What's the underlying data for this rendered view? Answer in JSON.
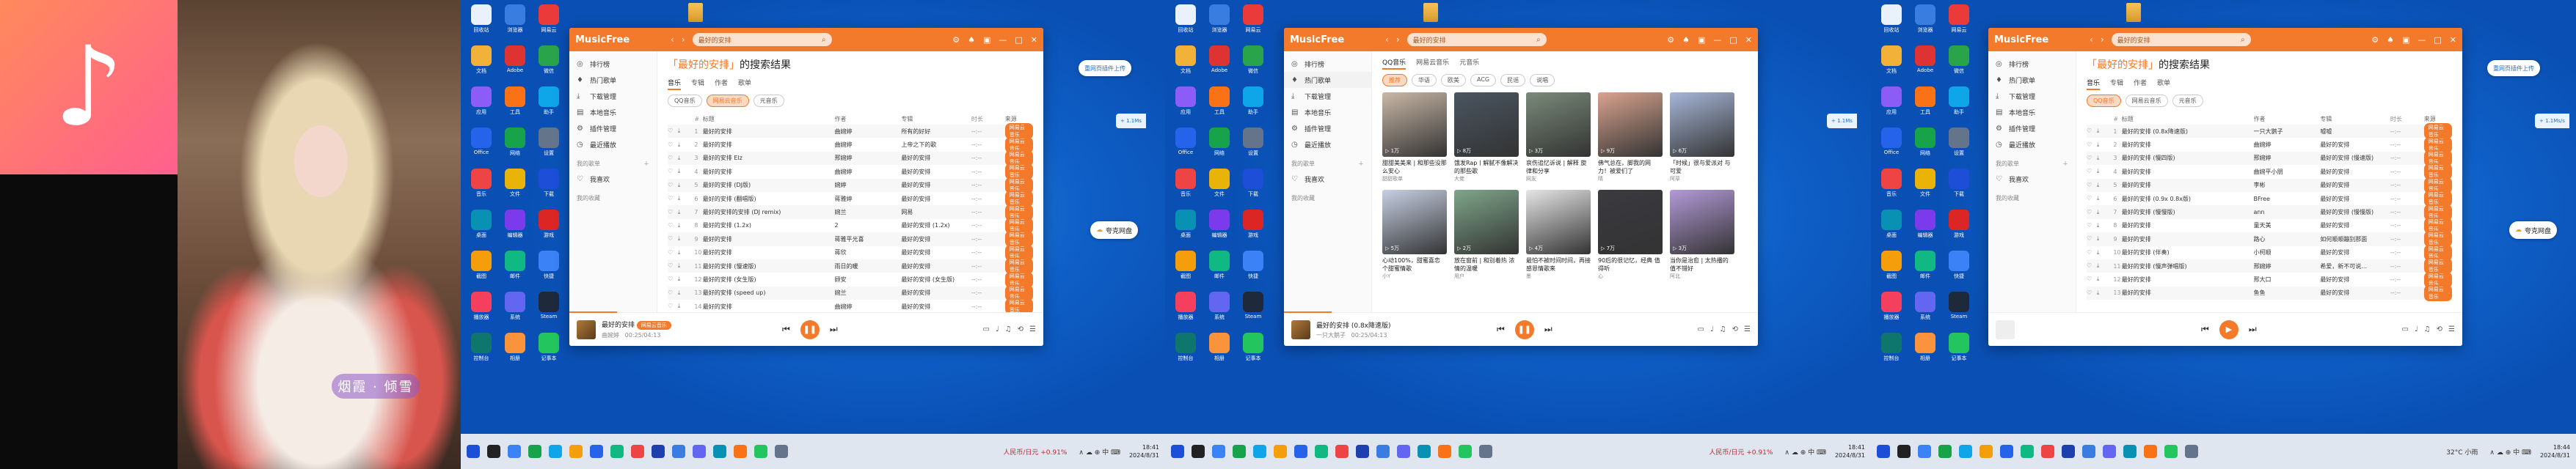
{
  "promo": {
    "caption": "烟霞 · 倾雪"
  },
  "app": {
    "name": "MusicFree",
    "search_value": "最好的安排",
    "window_controls": [
      "⚙",
      "♠",
      "▣",
      "—",
      "□",
      "✕"
    ]
  },
  "sidebar": {
    "items": [
      {
        "icon": "◎",
        "label": "排行榜"
      },
      {
        "icon": "♦",
        "label": "热门歌单"
      },
      {
        "icon": "⤓",
        "label": "下载管理"
      },
      {
        "icon": "▤",
        "label": "本地音乐"
      },
      {
        "icon": "⚙",
        "label": "插件管理"
      },
      {
        "icon": "◷",
        "label": "最近播放"
      }
    ],
    "my_playlists": "我的歌单",
    "favorites": "我喜欢",
    "starred": "我的收藏"
  },
  "result_title": {
    "keyword": "「最好的安排」",
    "suffix": "的搜索结果"
  },
  "tabs": [
    "音乐",
    "专辑",
    "作者",
    "歌单"
  ],
  "tabs2": [
    "音乐",
    "专辑",
    "作者",
    "歌单"
  ],
  "plugins1": [
    "QQ音乐",
    "网易云音乐",
    "元音乐"
  ],
  "plugins2_head": [
    "QQ音乐",
    "网易云音乐",
    "元音乐"
  ],
  "plugins2": [
    "推荐",
    "华语",
    "欧美",
    "ACG",
    "民谣",
    "说唱"
  ],
  "columns": {
    "title": "标题",
    "artist": "作者",
    "album": "专辑",
    "duration": "时长",
    "source": "来源"
  },
  "songs1": [
    {
      "title": "最好的安排",
      "artist": "曲婉婷",
      "album": "所有的好好",
      "dur": "--:--",
      "src": "网易云音乐"
    },
    {
      "title": "最好的安排",
      "artist": "曲婉婷",
      "album": "上帝之下的歌",
      "dur": "--:--",
      "src": "网易云音乐"
    },
    {
      "title": "最好的安排 Elz",
      "artist": "邢婉婷",
      "album": "最好的安排",
      "dur": "--:--",
      "src": "网易云音乐"
    },
    {
      "title": "最好的安排",
      "artist": "曲婉婷",
      "album": "最好的安排",
      "dur": "--:--",
      "src": "网易云音乐"
    },
    {
      "title": "最好的安排 (DJ版)",
      "artist": "婉婷",
      "album": "最好的安排",
      "dur": "--:--",
      "src": "网易云音乐"
    },
    {
      "title": "最好的安排 (翻唱版)",
      "artist": "蒋雅婷",
      "album": "最好的安排",
      "dur": "--:--",
      "src": "网易云音乐"
    },
    {
      "title": "最好的安排的安排 (DJ remix)",
      "artist": "婉兰",
      "album": "网易",
      "dur": "--:--",
      "src": "网易云音乐"
    },
    {
      "title": "最好的安排 (1.2x)",
      "artist": "2",
      "album": "最好的安排 (1.2x)",
      "dur": "--:--",
      "src": "网易云音乐"
    },
    {
      "title": "最好的安排",
      "artist": "蒋雅平光喜",
      "album": "最好的安排",
      "dur": "--:--",
      "src": "网易云音乐"
    },
    {
      "title": "最好的安排",
      "artist": "蒋欣",
      "album": "最好的安排",
      "dur": "--:--",
      "src": "网易云音乐"
    },
    {
      "title": "最好的安排 (慢速版)",
      "artist": "雨日的暖",
      "album": "最好的安排",
      "dur": "--:--",
      "src": "网易云音乐"
    },
    {
      "title": "最好的安排 (女生版)",
      "artist": "顾安",
      "album": "最好的安排 (女生版)",
      "dur": "--:--",
      "src": "网易云音乐"
    },
    {
      "title": "最好的安排 (speed up)",
      "artist": "婉兰",
      "album": "最好的安排",
      "dur": "--:--",
      "src": "网易云音乐"
    },
    {
      "title": "最好的安排",
      "artist": "曲婉婷",
      "album": "最好的安排",
      "dur": "--:--",
      "src": "网易云音乐"
    }
  ],
  "songs3": [
    {
      "title": "最好的安排 (0.8x降速版)",
      "artist": "一只大鹅子",
      "album": "嘘嘘",
      "dur": "--:--",
      "src": "网易云音乐"
    },
    {
      "title": "最好的安排",
      "artist": "曲婉婷",
      "album": "最好的安排",
      "dur": "--:--",
      "src": "网易云音乐"
    },
    {
      "title": "最好的安排 (慢四版)",
      "artist": "邢婉婷",
      "album": "最好的安排 (慢速版)",
      "dur": "--:--",
      "src": "网易云音乐"
    },
    {
      "title": "最好的安排",
      "artist": "曲婉平小朋",
      "album": "最好的安排",
      "dur": "--:--",
      "src": "网易云音乐"
    },
    {
      "title": "最好的安排",
      "artist": "李彬",
      "album": "最好的安排",
      "dur": "--:--",
      "src": "网易云音乐"
    },
    {
      "title": "最好的安排 (0.9x 0.8x版)",
      "artist": "BFree",
      "album": "最好的安排",
      "dur": "--:--",
      "src": "网易云音乐"
    },
    {
      "title": "最好的安排 (慢慢版)",
      "artist": "ann",
      "album": "最好的安排 (慢慢版)",
      "dur": "--:--",
      "src": "网易云音乐"
    },
    {
      "title": "最好的安排",
      "artist": "童天美",
      "album": "最好的安排",
      "dur": "--:--",
      "src": "网易云音乐"
    },
    {
      "title": "最好的安排",
      "artist": "路心",
      "album": "如何顺顺蹦别那面",
      "dur": "--:--",
      "src": "网易云音乐"
    },
    {
      "title": "最好的安排 (伴奏)",
      "artist": "小柯顺",
      "album": "最好的安排",
      "dur": "--:--",
      "src": "网易云音乐"
    },
    {
      "title": "最好的安排 (慢声弹唱版)",
      "artist": "邢婉婷",
      "album": "希爱，新不可说...",
      "dur": "--:--",
      "src": "网易云音乐"
    },
    {
      "title": "最好的安排",
      "artist": "邢大口",
      "album": "最好的安排",
      "dur": "--:--",
      "src": "网易云音乐"
    },
    {
      "title": "最好的安排",
      "artist": "鱼鱼",
      "album": "最好的安排",
      "dur": "--:--",
      "src": "网易云音乐"
    }
  ],
  "albums": [
    {
      "title": "甜甜美美来 | 和那些没那么安心",
      "user": "甜甜歌单",
      "views": "▷ 1万"
    },
    {
      "title": "饿发Rap丨解腻不像解决 的那些歌",
      "user": "大佬",
      "views": "▷ 8万"
    },
    {
      "title": "哀伤追忆诉说 | 解释 旋律和分享",
      "user": "网友",
      "views": "▷ 3万"
    },
    {
      "title": "佛气总在，脚我的网 力！被爱们了",
      "user": "晴",
      "views": "▷ 9万"
    },
    {
      "title": "「时候」很与爱派对 与可爱",
      "user": "阿草",
      "views": "▷ 6万"
    },
    {
      "title": "心动100%，甜蜜喜恋 个甜蜜情歌",
      "user": "小Y",
      "views": "▷ 5万"
    },
    {
      "title": "放在窗前 | 和别着热 浓情的温暖",
      "user": "用户",
      "views": "▷ 2万"
    },
    {
      "title": "最怕不被时间时间，再接 感恩情歌来",
      "user": "墨",
      "views": "▷ 4万"
    },
    {
      "title": "90后的很记忆，经典 值得听",
      "user": "心",
      "views": "▷ 7万"
    },
    {
      "title": "当你是治愈 | 太热播的 值不错好",
      "user": "阿北",
      "views": "▷ 3万"
    }
  ],
  "player1": {
    "song": "最好的安排",
    "sub": "曲婉婷",
    "time": "00:25/04:13",
    "badge": "网易云音乐"
  },
  "player2": {
    "song": "最好的安排 (0.8x降速版)",
    "sub": "一只大鹅子",
    "time": "00:25/04:13"
  },
  "player3": {
    "song": "",
    "sub": "",
    "time": ""
  },
  "desktop": {
    "float_btn": "重网页插件上传",
    "side_tab1": "+ 1.1Ms",
    "side_tab2": "+ 1.1Ms/s",
    "cloud": "夸克网盘",
    "stock1": "人民币/日元 +0.91%",
    "stock3": "32°C 小雨",
    "clock1": "18:41",
    "date1": "2024/8/31",
    "clock2": "18:41",
    "date2": "2024/8/31",
    "clock3": "18:44",
    "date3": "2024/8/31",
    "sys_tray": "∧ ☁ ⊕ 中 ⌨"
  },
  "icon_labels": [
    "回收站",
    "浏览器",
    "网易云",
    "文档",
    "Adobe",
    "微信",
    "应用",
    "工具",
    "助手",
    "Office",
    "网络",
    "设置",
    "音乐",
    "文件",
    "下载",
    "桌面",
    "编辑器",
    "游戏",
    "截图",
    "邮件",
    "快捷",
    "播放器",
    "系统",
    "Steam",
    "控制台",
    "相册",
    "记事本"
  ],
  "icon_colors": [
    "#e9f1fb",
    "#3a7de0",
    "#ea3a3a",
    "#f2b23a",
    "#d33",
    "#2aa44b",
    "#8b5cf6",
    "#f97316",
    "#0ea5e9",
    "#2563eb",
    "#16a34a",
    "#64748b",
    "#ef4444",
    "#eab308",
    "#1d4ed8",
    "#0891b2",
    "#7c3aed",
    "#dc2626",
    "#f59e0b",
    "#10b981",
    "#3b82f6",
    "#f43f5e",
    "#6366f1",
    "#1e293b",
    "#0f766e",
    "#fb923c",
    "#22c55e"
  ]
}
